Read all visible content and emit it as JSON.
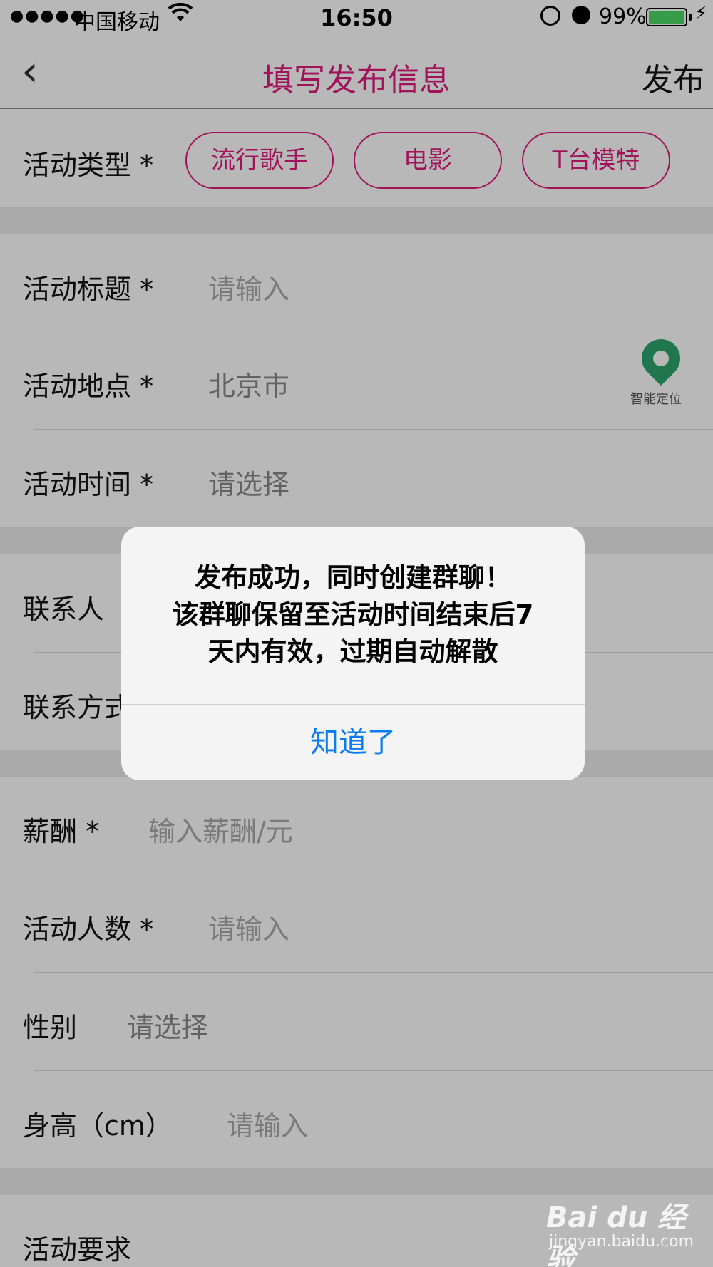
{
  "status_bar": {
    "signal": "●●●●●",
    "carrier": "中国移动",
    "wifi_icon": "wifi-icon",
    "time": "16:50",
    "battery_percent": "99%",
    "battery_level": 0.99,
    "charge_icon": "⚡",
    "battery_color": "#4cd964"
  },
  "nav": {
    "back_icon": "‹",
    "title": "填写发布信息",
    "publish_label": "发布",
    "accent_color": "#e0197f"
  },
  "activity_type": {
    "label": "活动类型 *",
    "options": [
      "流行歌手",
      "电影",
      "T台模特"
    ]
  },
  "form": {
    "title": {
      "label": "活动标题 *",
      "placeholder": "请输入"
    },
    "location": {
      "label": "活动地点 *",
      "value": "北京市",
      "locate_label": "智能定位"
    },
    "time": {
      "label": "活动时间 *",
      "value": "请选择"
    },
    "contact": {
      "label": "联系人"
    },
    "contact_method": {
      "label": "联系方式"
    },
    "salary": {
      "label": "薪酬 *",
      "placeholder": "输入薪酬/元"
    },
    "people": {
      "label": "活动人数 *",
      "placeholder": "请输入"
    },
    "gender": {
      "label": "性别",
      "value": "请选择"
    },
    "height": {
      "label": "身高（cm）",
      "placeholder": "请输入"
    },
    "requirements": {
      "label": "活动要求"
    }
  },
  "alert": {
    "line1": "发布成功，同时创建群聊！",
    "line2": "该群聊保留至活动时间结束后7",
    "line3": "天内有效，过期自动解散",
    "button": "知道了",
    "button_color": "#0a7cf0"
  },
  "watermark": {
    "logo": "Bai du 经验",
    "site": "jingyan.baidu.com"
  }
}
